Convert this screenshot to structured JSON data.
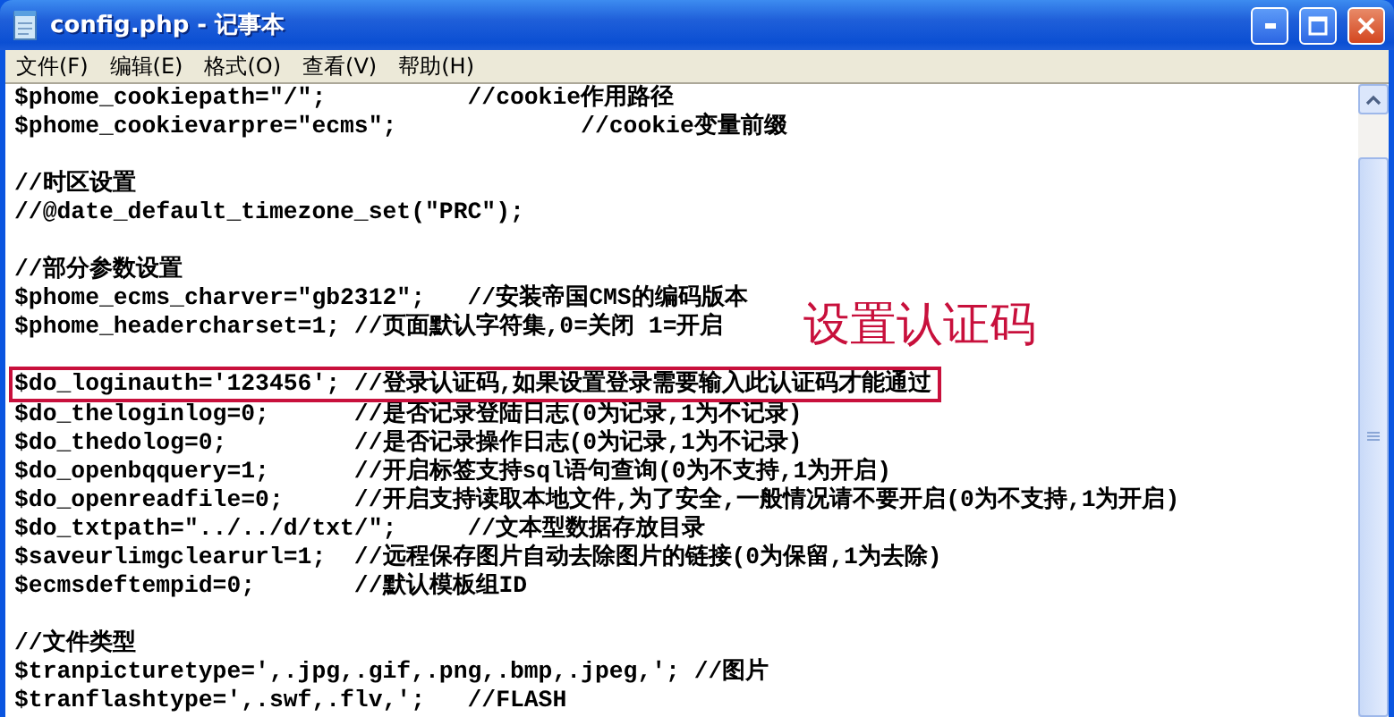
{
  "window": {
    "title": "config.php - 记事本"
  },
  "menu": [
    {
      "label": "文件(F)"
    },
    {
      "label": "编辑(E)"
    },
    {
      "label": "格式(O)"
    },
    {
      "label": "查看(V)"
    },
    {
      "label": "帮助(H)"
    }
  ],
  "blocks": [
    [
      {
        "text": "$phome_cookiepath=\"/\";          //cookie作用路径",
        "highlighted": false
      },
      {
        "text": "$phome_cookievarpre=\"ecms\";             //cookie变量前缀",
        "highlighted": false
      }
    ],
    [
      {
        "text": "//时区设置",
        "highlighted": false
      },
      {
        "text": "//@date_default_timezone_set(\"PRC\");",
        "highlighted": false
      }
    ],
    [
      {
        "text": "//部分参数设置",
        "highlighted": false
      },
      {
        "text": "$phome_ecms_charver=\"gb2312\";   //安装帝国CMS的编码版本",
        "highlighted": false
      },
      {
        "text": "$phome_headercharset=1; //页面默认字符集,0=关闭 1=开启",
        "highlighted": false
      }
    ],
    [
      {
        "text": "$do_loginauth='123456'; //登录认证码,如果设置登录需要输入此认证码才能通过",
        "highlighted": true
      },
      {
        "text": "$do_theloginlog=0;      //是否记录登陆日志(0为记录,1为不记录)",
        "highlighted": false
      },
      {
        "text": "$do_thedolog=0;         //是否记录操作日志(0为记录,1为不记录)",
        "highlighted": false
      },
      {
        "text": "$do_openbqquery=1;      //开启标签支持sql语句查询(0为不支持,1为开启)",
        "highlighted": false
      },
      {
        "text": "$do_openreadfile=0;     //开启支持读取本地文件,为了安全,一般情况请不要开启(0为不支持,1为开启)",
        "highlighted": false
      },
      {
        "text": "$do_txtpath=\"../../d/txt/\";     //文本型数据存放目录",
        "highlighted": false
      },
      {
        "text": "$saveurlimgclearurl=1;  //远程保存图片自动去除图片的链接(0为保留,1为去除)",
        "highlighted": false
      },
      {
        "text": "$ecmsdeftempid=0;       //默认模板组ID",
        "highlighted": false
      }
    ],
    [
      {
        "text": "//文件类型",
        "highlighted": false
      },
      {
        "text": "$tranpicturetype=',.jpg,.gif,.png,.bmp,.jpeg,'; //图片",
        "highlighted": false
      },
      {
        "text": "$tranflashtype=',.swf,.flv,';   //FLASH",
        "highlighted": false
      }
    ]
  ],
  "annotation": {
    "label": "设置认证码"
  }
}
